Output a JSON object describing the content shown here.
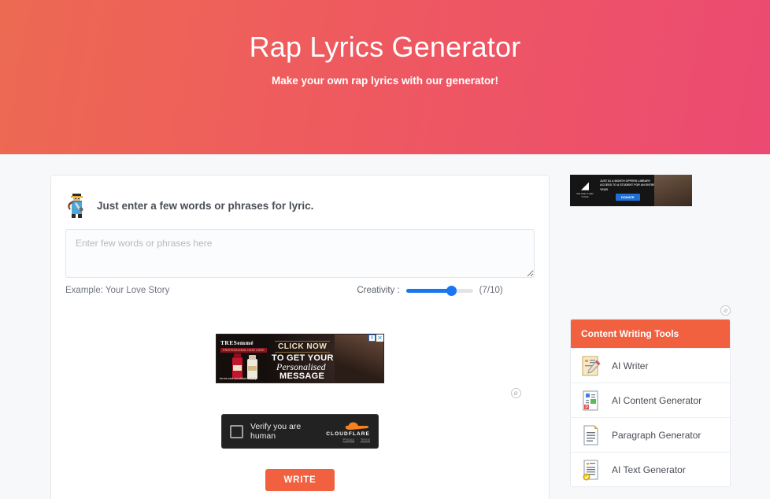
{
  "header": {
    "title": "Rap Lyrics Generator",
    "subtitle": "Make your own rap lyrics with our generator!",
    "gradient_from": "#ed6a52",
    "gradient_to": "#ec4a72"
  },
  "form": {
    "icon": "rapper-icon",
    "heading": "Just enter a few words or phrases for lyric.",
    "textarea_placeholder": "Enter few words or phrases here",
    "textarea_value": "",
    "example_text": "Example: Your Love Story",
    "creativity_label": "Creativity :",
    "creativity_value": "(7/10)",
    "creativity_level": 7,
    "creativity_max": 10,
    "slider_color": "#1976f2",
    "submit_label": "WRITE",
    "submit_color": "#f1603f"
  },
  "mid_ad": {
    "brand": "TRESemmé",
    "brand_tagline": "PROFESSIONAL HAIR CARE",
    "line1": "CLICK NOW",
    "line2": "TO GET YOUR",
    "line3": "Personalised",
    "line4": "MESSAGE",
    "terms": "terms and conditions apply",
    "badge_info": "i",
    "badge_close": "✕"
  },
  "turnstile": {
    "checkbox_state": "unchecked",
    "label": "Verify you are human",
    "brand": "CLOUDFLARE",
    "privacy_link": "Privacy",
    "separator": "-",
    "terms_link": "Terms"
  },
  "adchoices": {
    "icon": "adchoices-icon",
    "glyph": "⌀"
  },
  "sidebar": {
    "top_ad": {
      "logo_mark": "◢",
      "logo_text": "WE ARE THEIR VOICE",
      "copy": "JUST $1 A MONTH OFFERS LIBRARY ACCESS TO A STUDENT FOR AN ENTIRE YEAR",
      "button_label": "DONATE"
    },
    "panel_title": "Content Writing Tools",
    "panel_color": "#f1603f",
    "items": [
      {
        "label": "AI Writer",
        "icon": "notepad-pencil-icon"
      },
      {
        "label": "AI Content Generator",
        "icon": "document-image-icon"
      },
      {
        "label": "Paragraph Generator",
        "icon": "page-lines-icon"
      },
      {
        "label": "AI Text Generator",
        "icon": "document-check-icon"
      }
    ]
  }
}
